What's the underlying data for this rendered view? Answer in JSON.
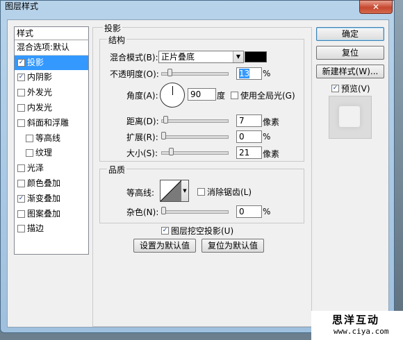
{
  "window": {
    "title": "图层样式",
    "close_glyph": "✕"
  },
  "style_list": {
    "header": "样式",
    "blend_options": "混合选项:默认",
    "items": [
      {
        "label": "投影",
        "checked": true,
        "selected": true
      },
      {
        "label": "内阴影",
        "checked": true
      },
      {
        "label": "外发光",
        "checked": false
      },
      {
        "label": "内发光",
        "checked": false
      },
      {
        "label": "斜面和浮雕",
        "checked": false
      },
      {
        "label": "等高线",
        "checked": false,
        "sub": true
      },
      {
        "label": "纹理",
        "checked": false,
        "sub": true
      },
      {
        "label": "光泽",
        "checked": false
      },
      {
        "label": "颜色叠加",
        "checked": false
      },
      {
        "label": "渐变叠加",
        "checked": true
      },
      {
        "label": "图案叠加",
        "checked": false
      },
      {
        "label": "描边",
        "checked": false
      }
    ]
  },
  "panel": {
    "title": "投影",
    "structure": {
      "title": "结构",
      "blend_mode_label": "混合模式(B):",
      "blend_mode_value": "正片叠底",
      "color": "#000000",
      "opacity_label": "不透明度(O):",
      "opacity_value": "13",
      "opacity_unit": "%",
      "angle_label": "角度(A):",
      "angle_value": "90",
      "angle_unit": "度",
      "global_light_label": "使用全局光(G)",
      "global_light_checked": false,
      "distance_label": "距离(D):",
      "distance_value": "7",
      "distance_unit": "像素",
      "spread_label": "扩展(R):",
      "spread_value": "0",
      "spread_unit": "%",
      "size_label": "大小(S):",
      "size_value": "21",
      "size_unit": "像素"
    },
    "quality": {
      "title": "品质",
      "contour_label": "等高线:",
      "antialias_label": "消除锯齿(L)",
      "antialias_checked": false,
      "noise_label": "杂色(N):",
      "noise_value": "0",
      "noise_unit": "%"
    },
    "knockout_label": "图层挖空投影(U)",
    "knockout_checked": true,
    "make_default": "设置为默认值",
    "reset_default": "复位为默认值"
  },
  "buttons": {
    "ok": "确定",
    "reset": "复位",
    "new_style": "新建样式(W)...",
    "preview_label": "预览(V)",
    "preview_checked": true
  },
  "watermark": {
    "name": "思洋互动",
    "url": "www.ciya.com"
  }
}
